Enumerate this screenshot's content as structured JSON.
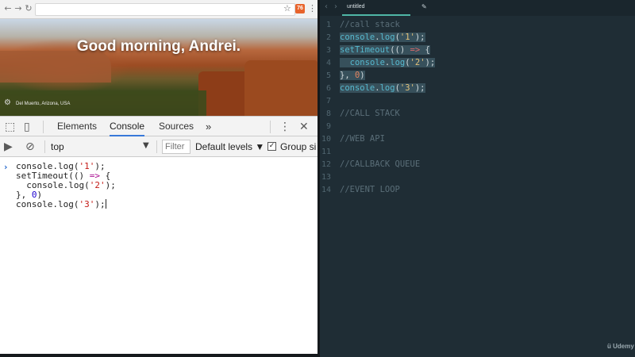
{
  "browser": {
    "url": "",
    "ext_badge": "76",
    "hero": {
      "greeting": "Good morning, Andrei.",
      "location": "Del Muerto, Arizona, USA"
    },
    "devtools": {
      "tabs": [
        "Elements",
        "Console",
        "Sources"
      ],
      "active_tab": "Console",
      "more_tabs": "»",
      "context": "top",
      "filter_placeholder": "Filter",
      "levels": "Default levels ▼",
      "group_label": "Group si",
      "group_checked": true,
      "console_lines": [
        "console.log('1');",
        "setTimeout(() => {",
        "  console.log('2');",
        "}, 0)",
        "console.log('3');"
      ]
    }
  },
  "editor": {
    "tab_label": "untitled",
    "line_numbers": [
      "1",
      "2",
      "3",
      "4",
      "5",
      "6",
      "7",
      "8",
      "9",
      "10",
      "11",
      "12",
      "13",
      "14"
    ],
    "lines": {
      "l1": "//call stack",
      "l8": "//CALL STACK",
      "l10": "//WEB API",
      "l12": "//CALLBACK QUEUE",
      "l14": "//EVENT LOOP"
    },
    "brand": "Udemy",
    "brand_mark": "ü"
  },
  "colors": {
    "editor_bg": "#1f2d35",
    "selection": "#37505b",
    "accent": "#4fb6a6",
    "devtools_active": "#3879d9"
  }
}
